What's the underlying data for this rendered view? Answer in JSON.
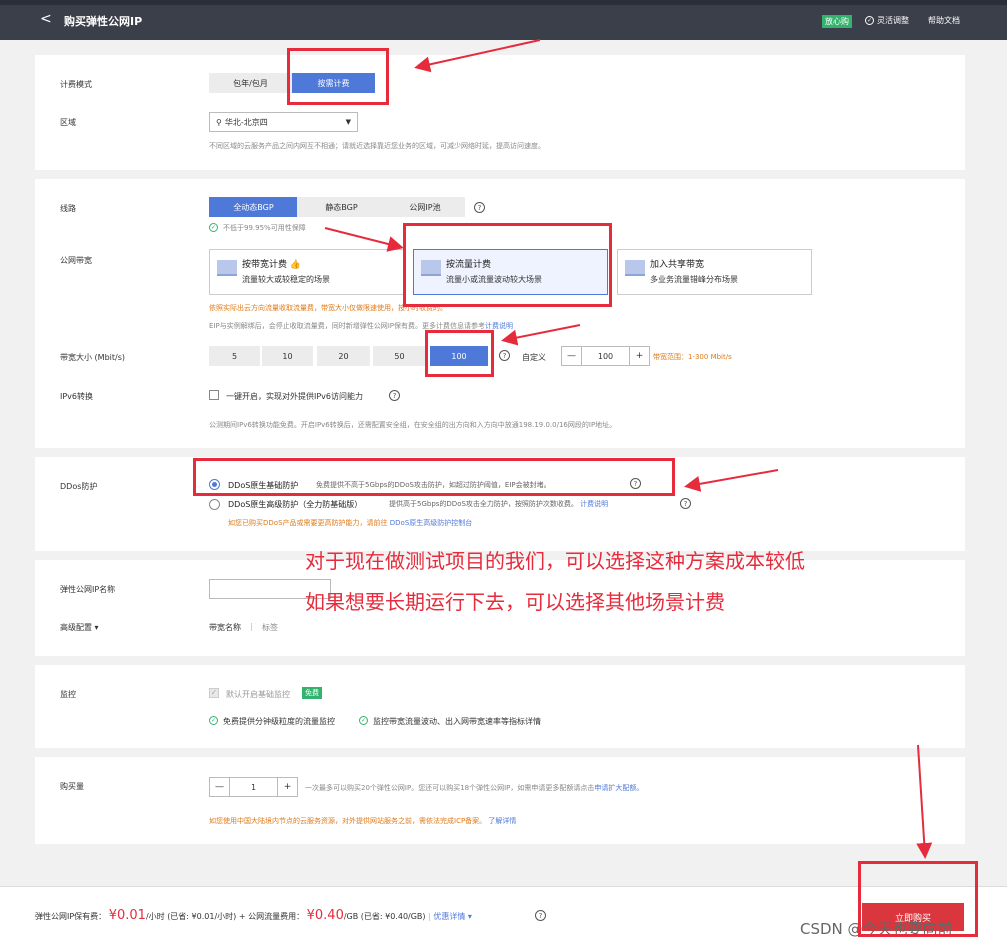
{
  "header": {
    "back": "<",
    "title": "购买弹性公网IP",
    "badge": "放心购",
    "adjust": "灵活调整",
    "help": "帮助文档"
  },
  "billing": {
    "label": "计费模式",
    "options": [
      "包年/包月",
      "按需计费"
    ]
  },
  "region": {
    "label": "区域",
    "value": "华北-北京四",
    "hint": "不同区域的云服务产品之间内网互不相通；请就近选择靠近您业务的区域，可减少网络时延，提高访问速度。"
  },
  "line": {
    "label": "线路",
    "options": [
      "全动态BGP",
      "静态BGP",
      "公网IP池"
    ],
    "hint": "不低于99.95%可用性保障"
  },
  "bandwidth": {
    "label": "公网带宽",
    "cards": [
      {
        "title": "按带宽计费",
        "desc": "流量较大或较稳定的场景"
      },
      {
        "title": "按流量计费",
        "desc": "流量小或流量波动较大场景"
      },
      {
        "title": "加入共享带宽",
        "desc": "多业务流量错峰分布场景"
      }
    ],
    "note1": "依照实际出云方向流量收取流量费，带宽大小仅做限速使用，按小时收费的。",
    "note2": "EIP与实例解绑后，会停止收取流量费，同时新增弹性公网IP保有费。更多计费信息请参考",
    "note2_link": "计费说明"
  },
  "size": {
    "label": "带宽大小 (Mbit/s)",
    "options": [
      "5",
      "10",
      "20",
      "50",
      "100"
    ],
    "custom": "自定义",
    "minus": "—",
    "value": "100",
    "plus": "+",
    "range": "带宽范围：1-300 Mbit/s"
  },
  "ipv6": {
    "label": "IPv6转换",
    "check": "一键开启，实现对外提供IPv6访问能力",
    "hint": "公测期间IPv6转换功能免费。开启IPv6转换后，还需配置安全组，在安全组的出方向和入方向中放通198.19.0.0/16网段的IP地址。"
  },
  "ddos": {
    "label": "DDos防护",
    "opt1": "DDoS原生基础防护",
    "opt1_desc": "免费提供不高于5Gbps的DDoS攻击防护，如超过防护阈值，EIP会被封堵。",
    "opt2": "DDoS原生高级防护（全力防基础版）",
    "opt2_desc": "提供高于5Gbps的DDoS攻击全力防护，按照防护次数收费。",
    "opt2_link": "计费说明",
    "note": "如您已购买DDoS产品或需要更高防护能力，请前往",
    "note_link": "DDoS原生高级防护控制台"
  },
  "annotation": {
    "line1": "对于现在做测试项目的我们，可以选择这种方案成本较低",
    "line2": "如果想要长期运行下去，可以选择其他场景计费"
  },
  "name": {
    "label": "弹性公网IP名称",
    "placeholder": ""
  },
  "advanced": {
    "label": "高级配置",
    "arrow": "▾",
    "tab1": "带宽名称",
    "sep": "|",
    "tab2": "标签"
  },
  "monitor": {
    "label": "监控",
    "check": "默认开启基础监控",
    "free": "免费",
    "feat1": "免费提供分钟级粒度的流量监控",
    "feat2": "监控带宽流量波动、出入网带宽速率等指标详情"
  },
  "quantity": {
    "label": "购买量",
    "value": "1",
    "note": "一次最多可以购买20个弹性公网IP。您还可以购买18个弹性公网IP，如需申请更多配额请点击",
    "note_link": "申请扩大配额。",
    "icp": "如您使用中国大陆境内节点的云服务资源，对外提供网站服务之前，需依法完成ICP备案。",
    "icp_link": "了解详情"
  },
  "footer": {
    "ip_fee_label": "弹性公网IP保有费：",
    "ip_fee": "¥0.01",
    "ip_fee_unit": "/小时 (已省: ¥0.01/小时)",
    "plus": "+",
    "flow_label": "公网流量费用：",
    "flow_fee": "¥0.40",
    "flow_unit": "/GB (已省: ¥0.40/GB)",
    "discount": "优惠详情 ▾",
    "buy": "立即购买"
  },
  "watermark": "CSDN @今天也要向前"
}
